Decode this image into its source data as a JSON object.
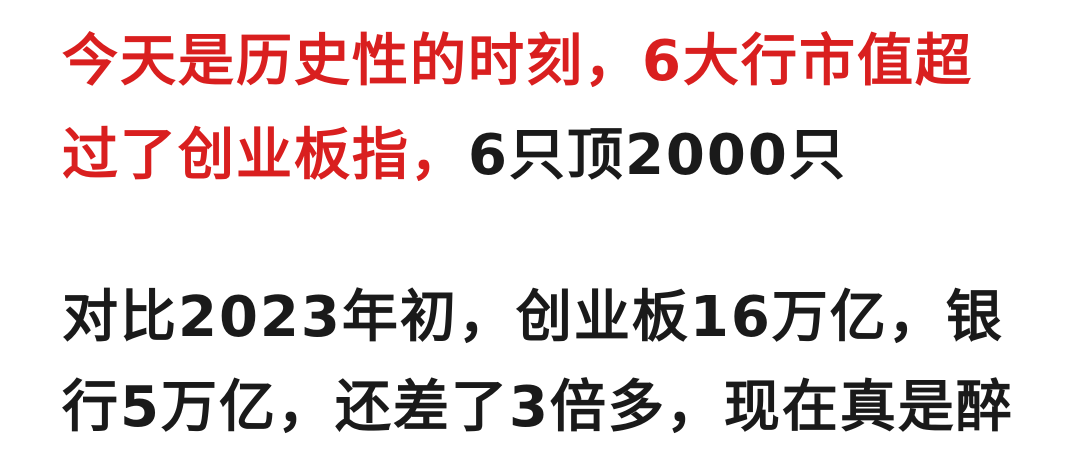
{
  "paragraph1": {
    "line1_red": "今天是历史性的时刻，6大行市值超",
    "line2_red": "过了创业板指，",
    "line2_black": "6只顶2000只"
  },
  "paragraph2": {
    "line1": "对比2023年初，创业板16万亿，银",
    "line2": "行5万亿，还差了3倍多，现在真是醉"
  },
  "colors": {
    "highlight": "#d91f1f",
    "text": "#1a1a1a",
    "background": "#ffffff"
  }
}
